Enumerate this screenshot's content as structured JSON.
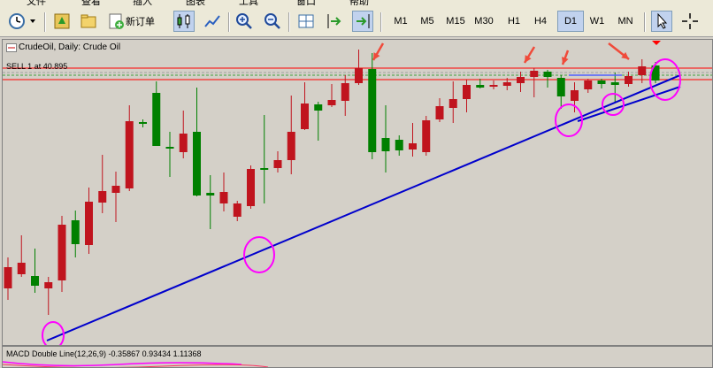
{
  "menu": [
    "文件",
    "查看",
    "插入",
    "图表",
    "工具",
    "窗口",
    "帮助"
  ],
  "toolbar": {
    "new_order_label": "新订单",
    "timeframes": [
      "M1",
      "M5",
      "M15",
      "M30",
      "H1",
      "H4",
      "D1",
      "W1",
      "MN"
    ],
    "active_timeframe": "D1"
  },
  "chart": {
    "title": "CrudeOil, Daily:  Crude Oil",
    "order_label": "SELL 1 at 40.895",
    "indicator_label": "MACD Double Line(12,26,9) -0.35867 0.93434 1.11368",
    "colors": {
      "bull": "#008000",
      "bear": "#c0141e",
      "trendline": "#0000cc",
      "circle": "#ff00ff",
      "arrow": "#f04a3a",
      "order_line": "#ff0000",
      "bid_line": "#c0c0c0"
    }
  },
  "chart_data": {
    "type": "candlestick",
    "candles": [
      {
        "dir": "bear",
        "o": 301,
        "c": 325,
        "h": 290,
        "l": 338
      },
      {
        "dir": "bear",
        "o": 296,
        "c": 309,
        "h": 265,
        "l": 312
      },
      {
        "dir": "bull",
        "o": 322,
        "c": 311,
        "h": 280,
        "l": 330
      },
      {
        "dir": "bear",
        "o": 318,
        "c": 325,
        "h": 312,
        "l": 355
      },
      {
        "dir": "bear",
        "o": 253,
        "c": 316,
        "h": 243,
        "l": 329
      },
      {
        "dir": "bull",
        "o": 275,
        "c": 248,
        "h": 237,
        "l": 290
      },
      {
        "dir": "bear",
        "o": 227,
        "c": 276,
        "h": 211,
        "l": 286
      },
      {
        "dir": "bear",
        "o": 215,
        "c": 228,
        "h": 174,
        "l": 240
      },
      {
        "dir": "bear",
        "o": 209,
        "c": 217,
        "h": 193,
        "l": 250
      },
      {
        "dir": "bear",
        "o": 136,
        "c": 212,
        "h": 118,
        "l": 215
      },
      {
        "dir": "bull",
        "o": 137,
        "c": 139,
        "h": 134,
        "l": 143
      },
      {
        "dir": "bull",
        "o": 164,
        "c": 104,
        "h": 91,
        "l": 164
      },
      {
        "dir": "bull",
        "o": 167,
        "c": 165,
        "h": 148,
        "l": 199
      },
      {
        "dir": "bear",
        "o": 150,
        "c": 171,
        "h": 124,
        "l": 178
      },
      {
        "dir": "bull",
        "o": 220,
        "c": 148,
        "h": 98,
        "l": 221
      },
      {
        "dir": "bull",
        "o": 220,
        "c": 217,
        "h": 197,
        "l": 258
      },
      {
        "dir": "bear",
        "o": 216,
        "c": 229,
        "h": 194,
        "l": 238
      },
      {
        "dir": "bear",
        "o": 229,
        "c": 244,
        "h": 226,
        "l": 249
      },
      {
        "dir": "bear",
        "o": 190,
        "c": 232,
        "h": 186,
        "l": 235
      },
      {
        "dir": "bull",
        "o": 191,
        "c": 189,
        "h": 129,
        "l": 229
      },
      {
        "dir": "bear",
        "o": 180,
        "c": 189,
        "h": 170,
        "l": 194
      },
      {
        "dir": "bear",
        "o": 148,
        "c": 180,
        "h": 107,
        "l": 196
      },
      {
        "dir": "bear",
        "o": 116,
        "c": 145,
        "h": 92,
        "l": 146
      },
      {
        "dir": "bull",
        "o": 117,
        "c": 124,
        "h": 114,
        "l": 158
      },
      {
        "dir": "bear",
        "o": 112,
        "c": 118,
        "h": 94,
        "l": 120
      },
      {
        "dir": "bear",
        "o": 93,
        "c": 113,
        "h": 84,
        "l": 130
      },
      {
        "dir": "bear",
        "o": 76,
        "c": 93,
        "h": 55,
        "l": 95
      },
      {
        "dir": "bull",
        "o": 77,
        "c": 171,
        "h": 59,
        "l": 179
      },
      {
        "dir": "bull",
        "o": 155,
        "c": 170,
        "h": 118,
        "l": 194
      },
      {
        "dir": "bull",
        "o": 157,
        "c": 169,
        "h": 152,
        "l": 175
      },
      {
        "dir": "bear",
        "o": 161,
        "c": 168,
        "h": 138,
        "l": 176
      },
      {
        "dir": "bear",
        "o": 135,
        "c": 171,
        "h": 130,
        "l": 175
      },
      {
        "dir": "bear",
        "o": 119,
        "c": 134,
        "h": 110,
        "l": 137
      },
      {
        "dir": "bear",
        "o": 111,
        "c": 121,
        "h": 91,
        "l": 138
      },
      {
        "dir": "bear",
        "o": 95,
        "c": 111,
        "h": 89,
        "l": 126
      },
      {
        "dir": "bull",
        "o": 95,
        "c": 98,
        "h": 88,
        "l": 99
      },
      {
        "dir": "bear",
        "o": 95,
        "c": 97,
        "h": 90,
        "l": 100
      },
      {
        "dir": "bear",
        "o": 92,
        "c": 96,
        "h": 87,
        "l": 101
      },
      {
        "dir": "bear",
        "o": 86,
        "c": 93,
        "h": 80,
        "l": 103
      },
      {
        "dir": "bear",
        "o": 79,
        "c": 86,
        "h": 76,
        "l": 109
      },
      {
        "dir": "bull",
        "o": 80,
        "c": 86,
        "h": 78,
        "l": 98
      },
      {
        "dir": "bull",
        "o": 87,
        "c": 108,
        "h": 84,
        "l": 122
      },
      {
        "dir": "bear",
        "o": 101,
        "c": 113,
        "h": 92,
        "l": 126
      },
      {
        "dir": "bear",
        "o": 90,
        "c": 100,
        "h": 88,
        "l": 104
      },
      {
        "dir": "bull",
        "o": 90,
        "c": 94,
        "h": 88,
        "l": 99
      },
      {
        "dir": "bull",
        "o": 92,
        "c": 95,
        "h": 81,
        "l": 115
      },
      {
        "dir": "bear",
        "o": 85,
        "c": 94,
        "h": 80,
        "l": 97
      },
      {
        "dir": "bear",
        "o": 74,
        "c": 84,
        "h": 66,
        "l": 93
      },
      {
        "dir": "bull",
        "o": 73,
        "c": 90,
        "h": 69,
        "l": 93
      }
    ]
  }
}
